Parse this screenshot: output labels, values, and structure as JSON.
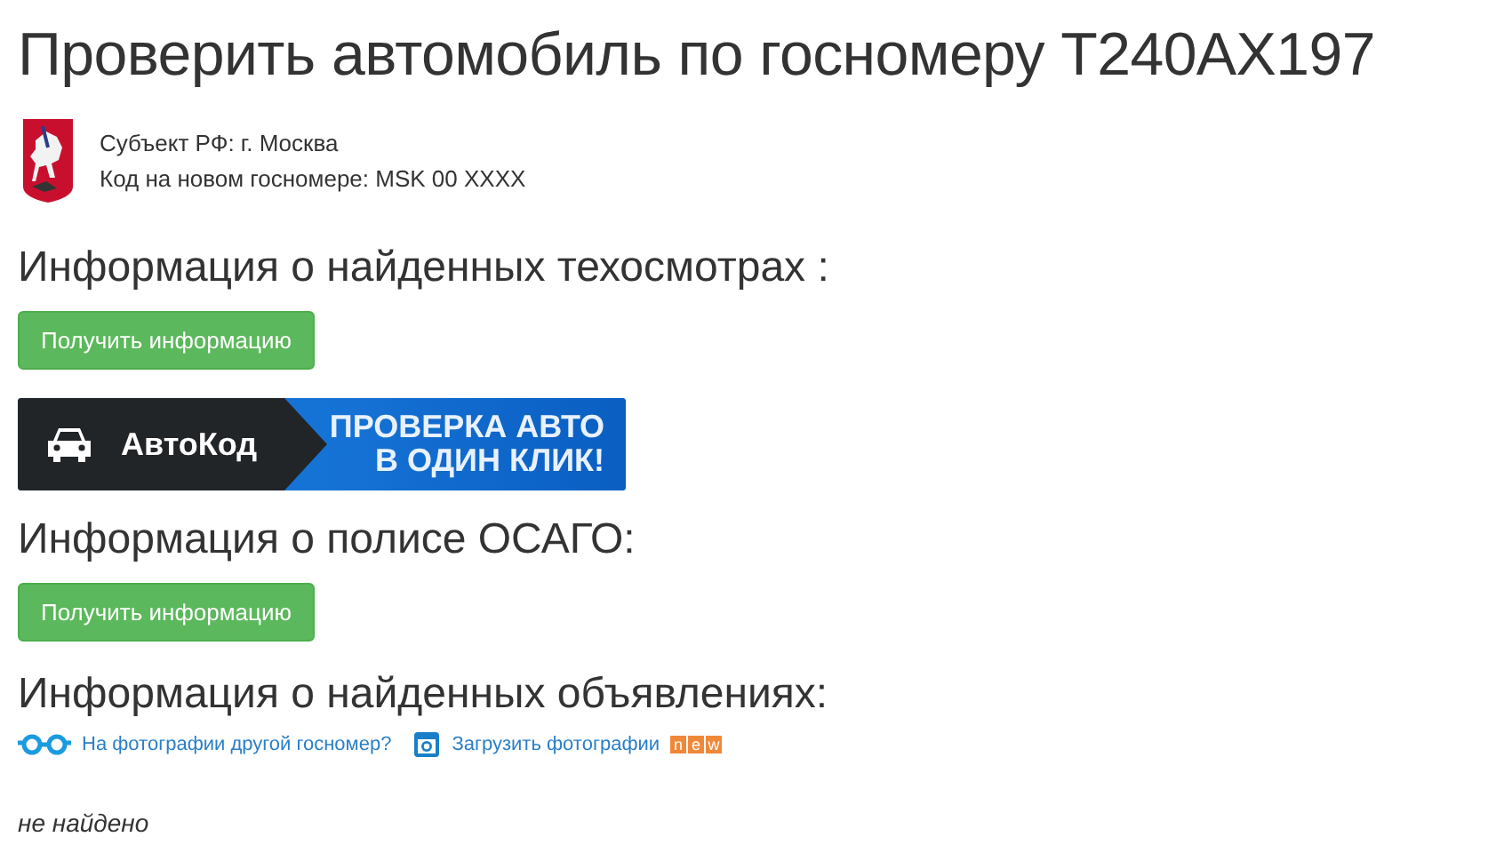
{
  "title": "Проверить автомобиль по госномеру Т240АХ197",
  "region": {
    "subject": "Субъект РФ: г. Москва",
    "code": "Код на новом госномере: MSK 00 XXXX"
  },
  "sections": [
    {
      "kind": "button",
      "heading": "Информация о найденных техосмотрах :",
      "button": "Получить информацию"
    },
    {
      "kind": "banner",
      "brand": "АвтоКод",
      "line1": "ПРОВЕРКА АВТО",
      "line2": "В ОДИН КЛИК!"
    },
    {
      "kind": "button",
      "heading": "Информация о полисе ОСАГО:",
      "button": "Получить информацию"
    },
    {
      "kind": "ads",
      "heading": "Информация о найденных объявлениях:",
      "link1": "На фотографии другой госномер?",
      "link2": "Загрузить фотографии",
      "badge": [
        "n",
        "e",
        "w"
      ],
      "result": "не найдено"
    }
  ]
}
